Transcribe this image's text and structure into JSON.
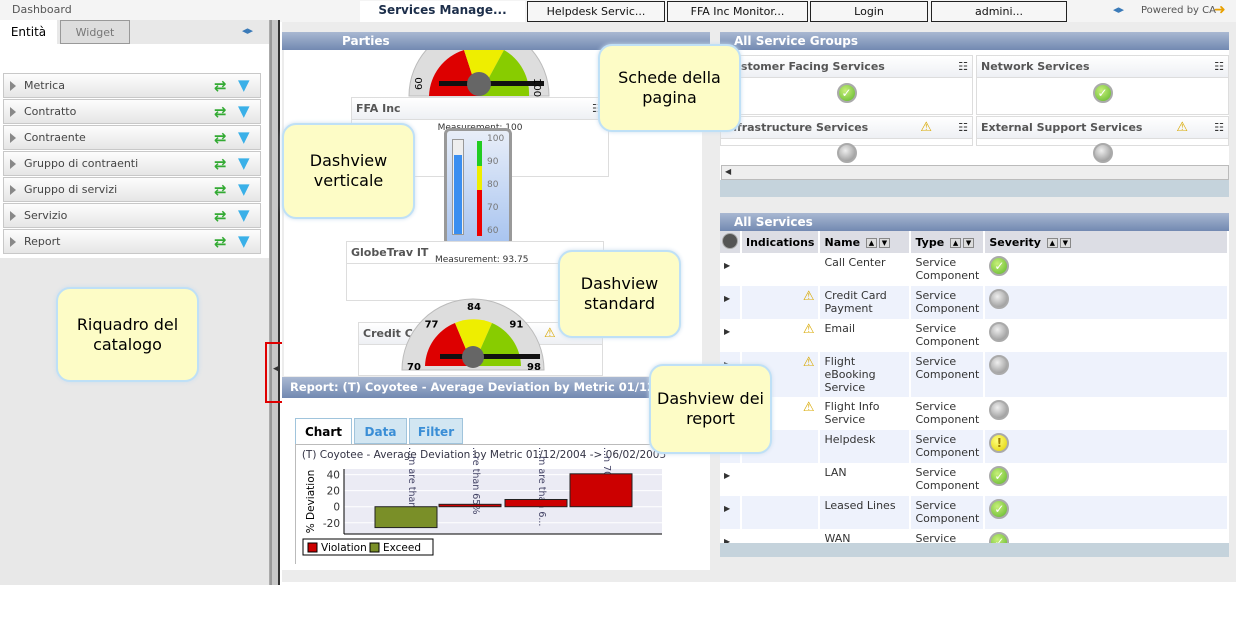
{
  "topbar": {
    "dashboard_label": "Dashboard",
    "tabs": [
      "Services Manage...",
      "Helpdesk Servic...",
      "FFA Inc Monitor...",
      "Login",
      "admini..."
    ],
    "powered_by": "Powered by CA"
  },
  "left": {
    "tabs": [
      "Entità",
      "Widget"
    ],
    "items": [
      "Metrica",
      "Contratto",
      "Contraente",
      "Gruppo di contraenti",
      "Gruppo di servizi",
      "Servizio",
      "Report"
    ]
  },
  "parties": {
    "title": "Parties",
    "ffa": "FFA Inc",
    "measurement_top": "Measurement: 100",
    "globe": "GlobeTrav IT",
    "measurement_vert": "Measurement: 93.75",
    "vert_value": 93.75,
    "vert_ticks": [
      "100",
      "90",
      "80",
      "70",
      "60"
    ],
    "credit": "Credit C",
    "top_gauge_ticks": [
      "60",
      "100"
    ],
    "std_gauge_ticks": [
      "70",
      "77",
      "84",
      "91",
      "98"
    ]
  },
  "report": {
    "title": "Report: (T) Coyotee - Average Deviation by Metric 01/12/2004 ->",
    "tabs": [
      "Chart",
      "Data",
      "Filter"
    ]
  },
  "chart_data": {
    "type": "bar",
    "title": "(T) Coyotee - Average Deviation by Metric 01/12/2004 -> 06/02/2005",
    "ylabel": "% Deviation",
    "xlabel": "",
    "ylim": [
      -34,
      47
    ],
    "yticks": [
      "40",
      "20",
      "0",
      "-20"
    ],
    "categories": [
      "...m are than 6...",
      "...re than 65%",
      "...m are than 6...",
      "...n 70%"
    ],
    "series": [
      {
        "name": "Violation",
        "color": "#cc0000",
        "values": [
          null,
          3,
          9,
          41
        ]
      },
      {
        "name": "Exceed",
        "color": "#7a8f28",
        "values": [
          -26,
          null,
          null,
          null
        ]
      }
    ],
    "legend": "bottom-left"
  },
  "groups": {
    "title": "All Service Groups",
    "items": [
      {
        "name": "Customer Facing Services",
        "status": "ok"
      },
      {
        "name": "Network Services",
        "status": "ok"
      },
      {
        "name": "Infrastructure Services",
        "status": "unknown"
      },
      {
        "name": "External Support Services",
        "status": "unknown"
      }
    ]
  },
  "services": {
    "title": "All Services",
    "columns": [
      "Indications",
      "Name",
      "Type",
      "Severity"
    ],
    "rows": [
      {
        "name": "Call Center",
        "type": "Service Component",
        "sev": "ok",
        "warn": false
      },
      {
        "name": "Credit Card Payment",
        "type": "Service Component",
        "sev": "grey",
        "warn": true
      },
      {
        "name": "Email",
        "type": "Service Component",
        "sev": "grey",
        "warn": true
      },
      {
        "name": "Flight eBooking Service",
        "type": "Service Component",
        "sev": "grey",
        "warn": true
      },
      {
        "name": "Flight Info Service",
        "type": "Service Component",
        "sev": "grey",
        "warn": true
      },
      {
        "name": "Helpdesk",
        "type": "Service Component",
        "sev": "yel",
        "warn": false
      },
      {
        "name": "LAN",
        "type": "Service Component",
        "sev": "ok",
        "warn": false
      },
      {
        "name": "Leased Lines",
        "type": "Service Component",
        "sev": "ok",
        "warn": false
      },
      {
        "name": "WAN",
        "type": "Service Component",
        "sev": "ok",
        "warn": false
      }
    ]
  },
  "callouts": {
    "tabs": "Schede della pagina",
    "vertical": "Dashview verticale",
    "standard": "Dashview standard",
    "reports": "Dashview dei report",
    "catalog": "Riquadro del catalogo"
  }
}
